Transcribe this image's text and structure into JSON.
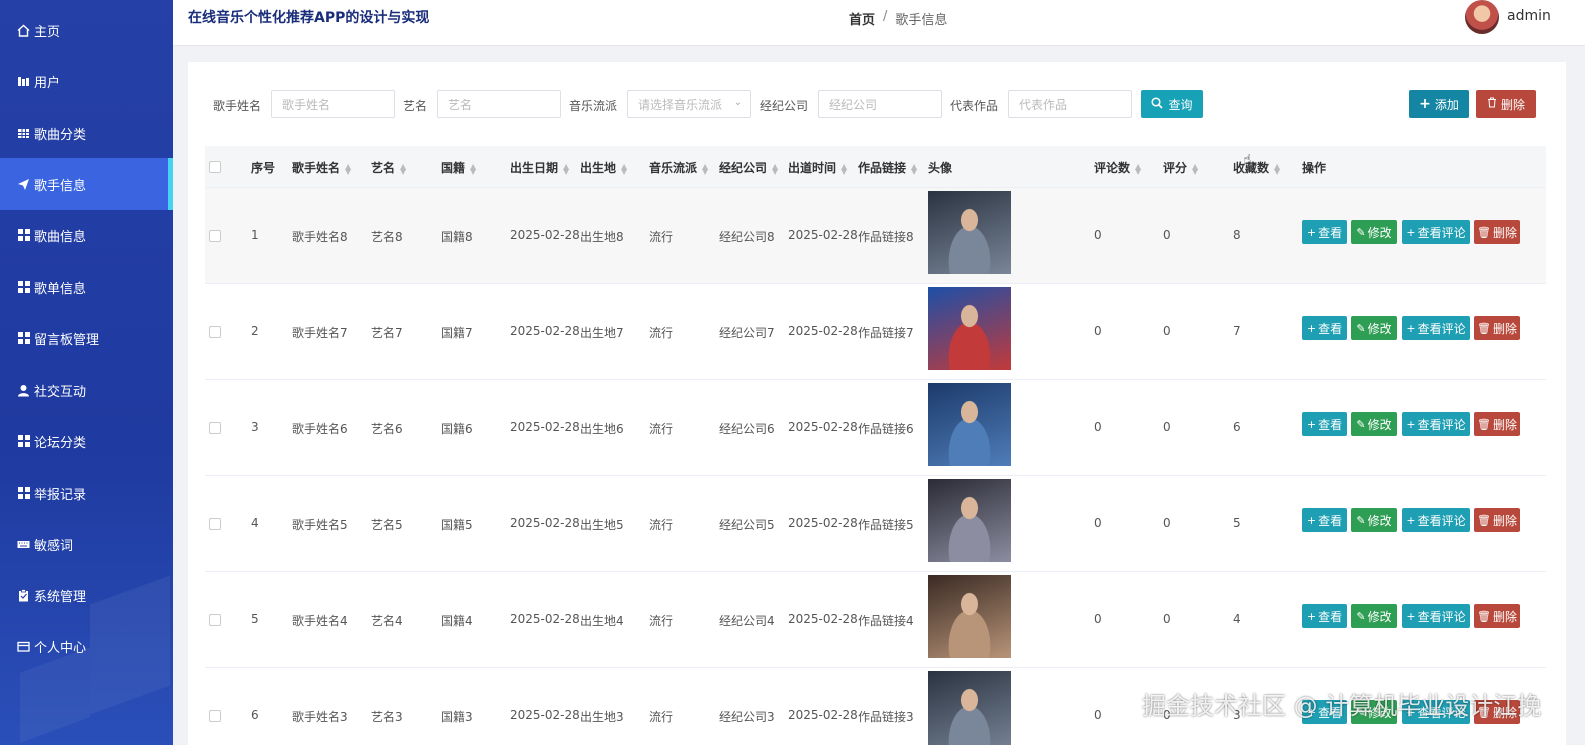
{
  "app": {
    "title": "在线音乐个性化推荐APP的设计与实现",
    "user": "admin"
  },
  "breadcrumb": {
    "home": "首页",
    "separator": "/",
    "current": "歌手信息"
  },
  "sidebar": {
    "items": [
      {
        "label": "主页",
        "icon": "home-icon"
      },
      {
        "label": "用户",
        "icon": "user-bars-icon"
      },
      {
        "label": "歌曲分类",
        "icon": "table-icon"
      },
      {
        "label": "歌手信息",
        "icon": "send-icon",
        "active": true
      },
      {
        "label": "歌曲信息",
        "icon": "grid-icon"
      },
      {
        "label": "歌单信息",
        "icon": "grid-icon"
      },
      {
        "label": "留言板管理",
        "icon": "grid-icon"
      },
      {
        "label": "社交互动",
        "icon": "person-icon"
      },
      {
        "label": "论坛分类",
        "icon": "grid-icon"
      },
      {
        "label": "举报记录",
        "icon": "grid-icon"
      },
      {
        "label": "敏感词",
        "icon": "keyboard-icon"
      },
      {
        "label": "系统管理",
        "icon": "clipboard-icon"
      },
      {
        "label": "个人中心",
        "icon": "card-icon"
      }
    ]
  },
  "search": {
    "singer_name_label": "歌手姓名",
    "singer_name_placeholder": "歌手姓名",
    "stage_name_label": "艺名",
    "stage_name_placeholder": "艺名",
    "genre_label": "音乐流派",
    "genre_placeholder": "请选择音乐流派",
    "company_label": "经纪公司",
    "company_placeholder": "经纪公司",
    "works_label": "代表作品",
    "works_placeholder": "代表作品",
    "query_button": "查询",
    "add_button": "添加",
    "delete_button": "删除"
  },
  "table": {
    "headers": [
      "序号",
      "歌手姓名",
      "艺名",
      "国籍",
      "出生日期",
      "出生地",
      "音乐流派",
      "经纪公司",
      "出道时间",
      "作品链接",
      "头像",
      "评论数",
      "评分",
      "收藏数",
      "操作"
    ],
    "rows": [
      {
        "no": "1",
        "name": "歌手姓名8",
        "stage": "艺名8",
        "nation": "国籍8",
        "birth": "2025-02-28",
        "place": "出生地8",
        "genre": "流行",
        "company": "经纪公司8",
        "debut": "2025-02-28",
        "link": "作品链接8",
        "comments": "0",
        "score": "0",
        "fav": "8"
      },
      {
        "no": "2",
        "name": "歌手姓名7",
        "stage": "艺名7",
        "nation": "国籍7",
        "birth": "2025-02-28",
        "place": "出生地7",
        "genre": "流行",
        "company": "经纪公司7",
        "debut": "2025-02-28",
        "link": "作品链接7",
        "comments": "0",
        "score": "0",
        "fav": "7"
      },
      {
        "no": "3",
        "name": "歌手姓名6",
        "stage": "艺名6",
        "nation": "国籍6",
        "birth": "2025-02-28",
        "place": "出生地6",
        "genre": "流行",
        "company": "经纪公司6",
        "debut": "2025-02-28",
        "link": "作品链接6",
        "comments": "0",
        "score": "0",
        "fav": "6"
      },
      {
        "no": "4",
        "name": "歌手姓名5",
        "stage": "艺名5",
        "nation": "国籍5",
        "birth": "2025-02-28",
        "place": "出生地5",
        "genre": "流行",
        "company": "经纪公司5",
        "debut": "2025-02-28",
        "link": "作品链接5",
        "comments": "0",
        "score": "0",
        "fav": "5"
      },
      {
        "no": "5",
        "name": "歌手姓名4",
        "stage": "艺名4",
        "nation": "国籍4",
        "birth": "2025-02-28",
        "place": "出生地4",
        "genre": "流行",
        "company": "经纪公司4",
        "debut": "2025-02-28",
        "link": "作品链接4",
        "comments": "0",
        "score": "0",
        "fav": "4"
      },
      {
        "no": "6",
        "name": "歌手姓名3",
        "stage": "艺名3",
        "nation": "国籍3",
        "birth": "2025-02-28",
        "place": "出生地3",
        "genre": "流行",
        "company": "经纪公司3",
        "debut": "2025-02-28",
        "link": "作品链接3",
        "comments": "0",
        "score": "0",
        "fav": "3"
      }
    ],
    "actions": {
      "view": "查看",
      "edit": "修改",
      "view_comments": "查看评论",
      "delete": "删除"
    }
  },
  "watermark": "掘金技术社区 @ 计算机毕业设计江挽"
}
